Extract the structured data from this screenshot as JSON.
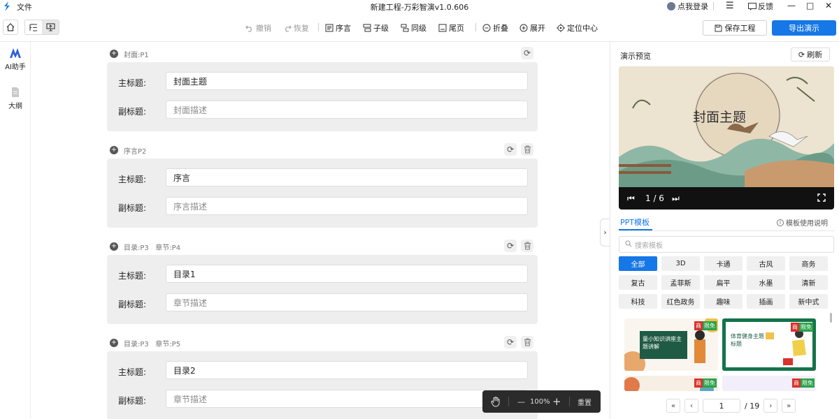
{
  "titlebar": {
    "menu_file": "文件",
    "title": "新建工程-万彩智演v1.0.606",
    "login": "点我登录",
    "feedback": "反馈",
    "minimize": "—",
    "maximize": "□",
    "close": "✕"
  },
  "toolbar": {
    "undo": "撤销",
    "redo": "恢复",
    "preface": "序言",
    "child": "子级",
    "sibling": "同级",
    "ending": "尾页",
    "fold": "折叠",
    "expand": "展开",
    "locate": "定位中心",
    "save": "保存工程",
    "export": "导出演示"
  },
  "leftnav": {
    "ai": "AI助手",
    "outline": "大纲"
  },
  "sections": [
    {
      "label": "封面:P1",
      "title_label": "主标题:",
      "title": "封面主题",
      "subtitle_label": "副标题:",
      "subtitle": "封面描述"
    },
    {
      "label": "序言P2",
      "title_label": "主标题:",
      "title": "序言",
      "subtitle_label": "副标题:",
      "subtitle": "序言描述"
    },
    {
      "label": "目录:P3   章节:P4",
      "title_label": "主标题:",
      "title": "目录1",
      "subtitle_label": "副标题:",
      "subtitle": "章节描述"
    },
    {
      "label": "目录:P3   章节:P5",
      "title_label": "主标题:",
      "title": "目录2",
      "subtitle_label": "副标题:",
      "subtitle": "章节描述"
    }
  ],
  "zoom": {
    "level": "100%",
    "minus": "—",
    "plus": "+",
    "reset": "重置"
  },
  "rightpanel": {
    "title": "演示预览",
    "refresh": "刷新",
    "preview_title": "封面主题",
    "page_indicator": "1 / 6",
    "tab": "PPT模板",
    "help": "模板使用说明",
    "search_placeholder": "搜索模板",
    "chips": [
      "全部",
      "3D",
      "卡通",
      "古风",
      "商务",
      "复古",
      "孟菲斯",
      "扁平",
      "水墨",
      "清新",
      "科技",
      "红色政务",
      "趣味",
      "插画",
      "新中式"
    ],
    "thumb1_text": "童小知识讲座主题讲解",
    "thumb2_text": "体育健身主题标题",
    "badge_a": "商",
    "badge_b": "限免",
    "page_current": "1",
    "page_total": "/ 19"
  },
  "colors": {
    "accent": "#1677e6",
    "badge_red": "#d9312c",
    "badge_green": "#2aa248"
  }
}
